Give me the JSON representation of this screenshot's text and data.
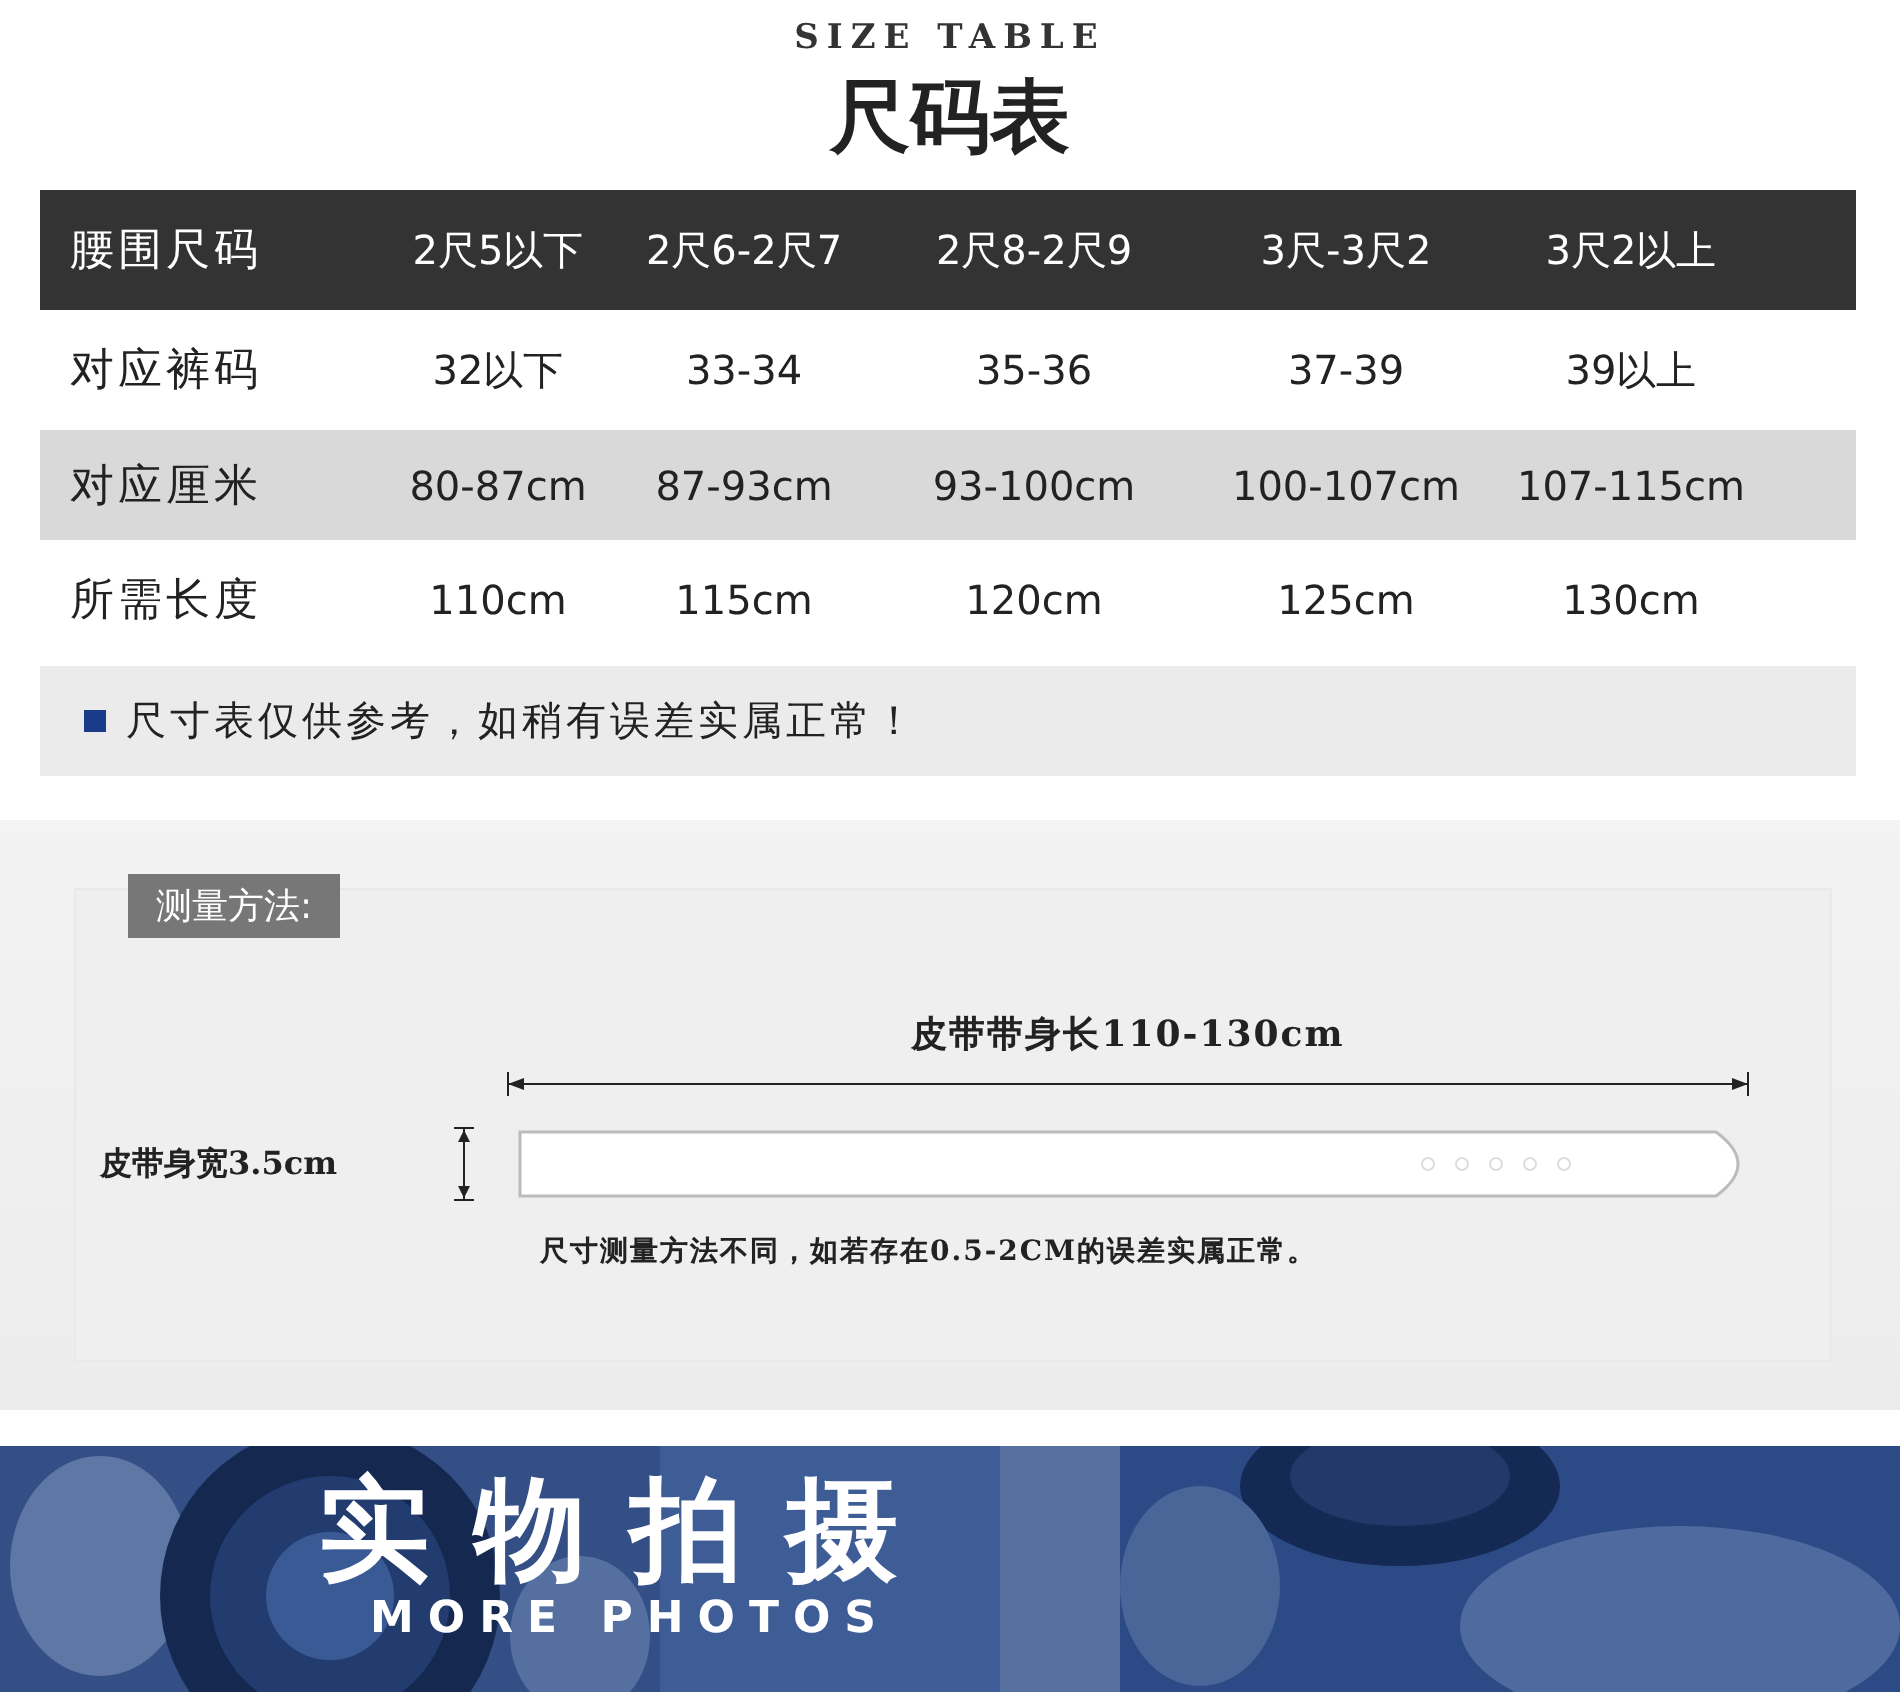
{
  "heading": {
    "subtitle": "SIZE TABLE",
    "title": "尺码表"
  },
  "size_table": {
    "rows": [
      {
        "kind": "header",
        "cells": [
          "腰围尺码",
          "2尺5以下",
          "2尺6-2尺7",
          "2尺8-2尺9",
          "3尺-3尺2",
          "3尺2以上"
        ]
      },
      {
        "kind": "plain",
        "cells": [
          "对应裤码",
          "32以下",
          "33-34",
          "35-36",
          "37-39",
          "39以上"
        ]
      },
      {
        "kind": "shaded",
        "cells": [
          "对应厘米",
          "80-87cm",
          "87-93cm",
          "93-100cm",
          "100-107cm",
          "107-115cm"
        ]
      },
      {
        "kind": "plain",
        "cells": [
          "所需长度",
          "110cm",
          "115cm",
          "120cm",
          "125cm",
          "130cm"
        ]
      }
    ],
    "note": "尺寸表仅供参考，如稍有误差实属正常！"
  },
  "measurement": {
    "label": "测量方法:",
    "length_label": "皮带带身长110-130cm",
    "width_label": "皮带身宽3.5cm",
    "note": "尺寸测量方法不同，如若存在0.5-2CM的误差实属正常。"
  },
  "banner": {
    "title": "实物拍摄",
    "subtitle": "MORE PHOTOS"
  }
}
